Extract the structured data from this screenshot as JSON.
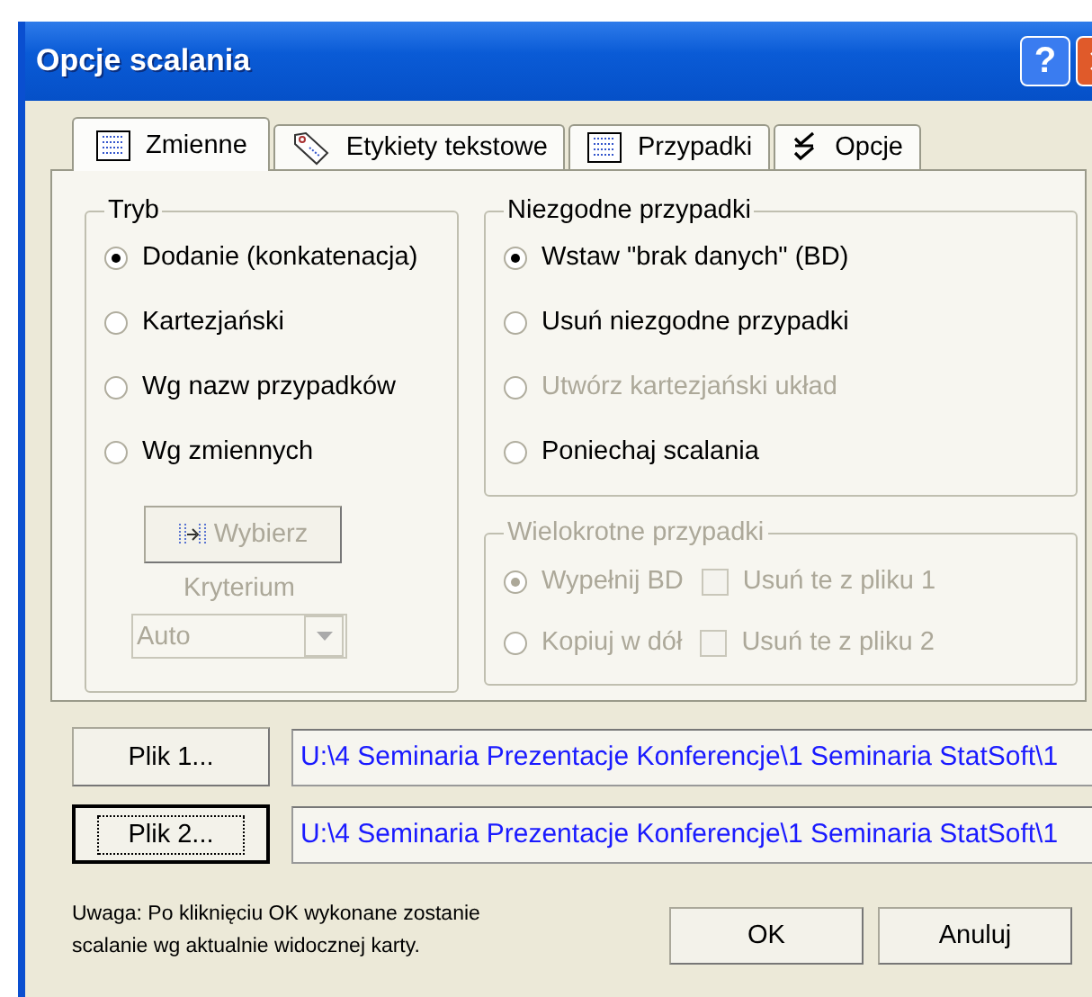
{
  "window": {
    "title": "Opcje scalania",
    "help_button": "?"
  },
  "tabs": [
    {
      "label": "Zmienne",
      "kind": "table",
      "selected": true
    },
    {
      "label": "Etykiety tekstowe",
      "kind": "tag",
      "selected": false
    },
    {
      "label": "Przypadki",
      "kind": "table",
      "selected": false
    },
    {
      "label": "Opcje",
      "kind": "checklist",
      "selected": false
    }
  ],
  "mode": {
    "title": "Tryb",
    "options": [
      {
        "label": "Dodanie (konkatenacja)",
        "selected": true,
        "disabled": false
      },
      {
        "label": "Kartezjański",
        "selected": false,
        "disabled": false
      },
      {
        "label": "Wg nazw przypadków",
        "selected": false,
        "disabled": false
      },
      {
        "label": "Wg zmiennych",
        "selected": false,
        "disabled": false
      }
    ],
    "select_button": {
      "label": "Wybierz",
      "disabled": true
    },
    "criterion": {
      "label": "Kryterium",
      "value": "Auto",
      "disabled": true
    }
  },
  "mismatched": {
    "title": "Niezgodne przypadki",
    "options": [
      {
        "label": "Wstaw \"brak danych\" (BD)",
        "selected": true,
        "disabled": false
      },
      {
        "label": "Usuń niezgodne przypadki",
        "selected": false,
        "disabled": false
      },
      {
        "label": "Utwórz kartezjański układ",
        "selected": false,
        "disabled": true
      },
      {
        "label": "Poniechaj scalania",
        "selected": false,
        "disabled": false
      }
    ]
  },
  "multiple": {
    "title": "Wielokrotne przypadki",
    "disabled": true,
    "rows": [
      {
        "option": {
          "label": "Wypełnij BD",
          "selected": true
        },
        "checkbox": {
          "label": "Usuń te z pliku 1",
          "checked": false
        }
      },
      {
        "option": {
          "label": "Kopiuj w dół",
          "selected": false
        },
        "checkbox": {
          "label": "Usuń te z pliku 2",
          "checked": false
        }
      }
    ]
  },
  "files": [
    {
      "button": "Plik 1...",
      "focused": false,
      "path": "U:\\4 Seminaria Prezentacje Konferencje\\1 Seminaria StatSoft\\1"
    },
    {
      "button": "Plik 2...",
      "focused": true,
      "path": "U:\\4 Seminaria Prezentacje Konferencje\\1 Seminaria StatSoft\\1"
    }
  ],
  "note": "Uwaga: Po kliknięciu OK wykonane zostanie scalanie wg aktualnie widocznej karty.",
  "buttons": [
    "OK",
    "Anuluj"
  ]
}
